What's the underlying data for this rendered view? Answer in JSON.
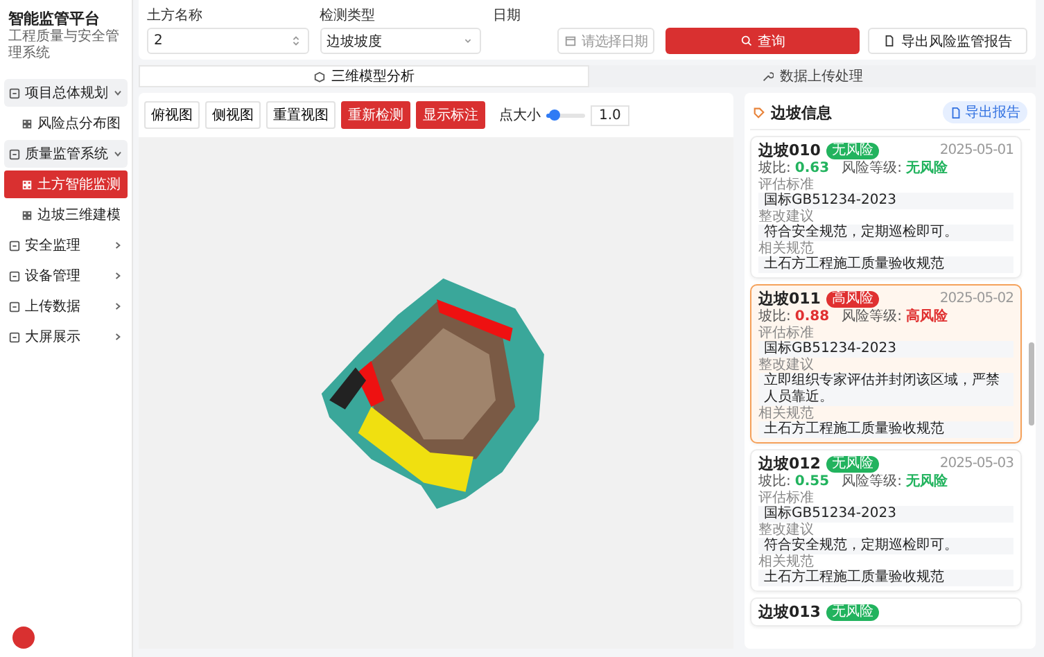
{
  "sidebar": {
    "title": "智能监管平台",
    "subtitle": "工程质量与安全管理系统",
    "items": [
      {
        "label": "项目总体规划",
        "expanded": true,
        "children": [
          {
            "label": "风险点分布图",
            "selected": false
          }
        ]
      },
      {
        "label": "质量监管系统",
        "expanded": true,
        "children": [
          {
            "label": "土方智能监测",
            "selected": true
          },
          {
            "label": "边坡三维建模",
            "selected": false
          }
        ]
      },
      {
        "label": "安全监理",
        "expanded": false
      },
      {
        "label": "设备管理",
        "expanded": false
      },
      {
        "label": "上传数据",
        "expanded": false
      },
      {
        "label": "大屏展示",
        "expanded": false
      }
    ]
  },
  "filters": [
    {
      "kind": "number",
      "label": "土方名称",
      "value": "2"
    },
    {
      "kind": "select",
      "label": "检测类型",
      "value": "边坡坡度"
    },
    {
      "kind": "date",
      "label": "日期",
      "placeholder": "请选择日期"
    }
  ],
  "actions": [
    {
      "kind": "primary",
      "label": "查询"
    },
    {
      "kind": "default",
      "label": "导出风险监管报告"
    }
  ],
  "tabs": [
    {
      "label": "三维模型分析",
      "selected": true
    },
    {
      "label": "数据上传处理",
      "selected": false
    }
  ],
  "toolbar": {
    "buttons": [
      {
        "label": "俯视图",
        "kind": "plain"
      },
      {
        "label": "侧视图",
        "kind": "plain"
      },
      {
        "label": "重置视图",
        "kind": "plain"
      },
      {
        "label": "重新检测",
        "kind": "danger"
      },
      {
        "label": "显示标注",
        "kind": "danger"
      }
    ],
    "point_size": {
      "label": "点大小",
      "level": 0.2,
      "reading": "1.0"
    }
  },
  "panel": {
    "title": "边坡信息",
    "export_label": "导出报告",
    "cards": [
      {
        "name": "边坡010",
        "badge": "无风险",
        "color": "#22b35e",
        "date": "2025-05-01",
        "selected": false,
        "metrics": [
          {
            "label": "坡比:",
            "value": "0.63"
          },
          {
            "label": "风险等级:",
            "value": "无风险"
          }
        ],
        "sections": [
          {
            "label": "评估标准",
            "value": "国标GB51234-2023"
          },
          {
            "label": "整改建议",
            "value": "符合安全规范，定期巡检即可。"
          },
          {
            "label": "相关规范",
            "value": "土石方工程施工质量验收规范"
          }
        ]
      },
      {
        "name": "边坡011",
        "badge": "高风险",
        "color": "#e03131",
        "date": "2025-05-02",
        "selected": true,
        "metrics": [
          {
            "label": "坡比:",
            "value": "0.88"
          },
          {
            "label": "风险等级:",
            "value": "高风险"
          }
        ],
        "sections": [
          {
            "label": "评估标准",
            "value": "国标GB51234-2023"
          },
          {
            "label": "整改建议",
            "value": "立即组织专家评估并封闭该区域，严禁人员靠近。"
          },
          {
            "label": "相关规范",
            "value": "土石方工程施工质量验收规范"
          }
        ]
      },
      {
        "name": "边坡012",
        "badge": "无风险",
        "color": "#22b35e",
        "date": "2025-05-03",
        "selected": false,
        "metrics": [
          {
            "label": "坡比:",
            "value": "0.55"
          },
          {
            "label": "风险等级:",
            "value": "无风险"
          }
        ],
        "sections": [
          {
            "label": "评估标准",
            "value": "国标GB51234-2023"
          },
          {
            "label": "整改建议",
            "value": "符合安全规范，定期巡检即可。"
          },
          {
            "label": "相关规范",
            "value": "土石方工程施工质量验收规范"
          }
        ]
      },
      {
        "name": "边坡013",
        "badge": "无风险",
        "color": "#22b35e",
        "selected": false
      }
    ]
  }
}
